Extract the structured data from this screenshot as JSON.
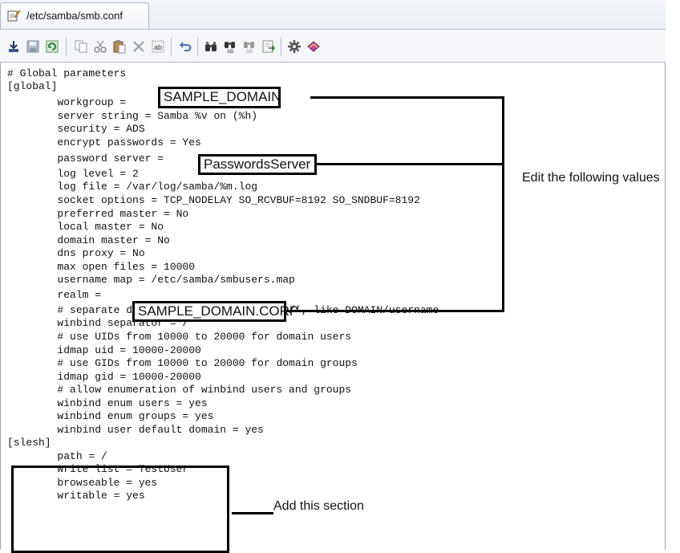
{
  "window": {
    "tab_title": "/etc/samba/smb.conf"
  },
  "toolbar": {
    "buttons": [
      "download-icon",
      "save-icon",
      "reload-icon",
      "copy-icon",
      "cut-icon",
      "paste-icon",
      "delete-icon",
      "select-all-icon",
      "undo-icon",
      "find-icon",
      "find-next-icon",
      "find-previous-icon",
      "go-to-line-icon",
      "settings-icon",
      "bookmark-icon"
    ]
  },
  "editor": {
    "lines": [
      "# Global parameters",
      "[global]",
      "        workgroup = ",
      "        server string = Samba %v on (%h)",
      "        security = ADS",
      "        encrypt passwords = Yes",
      "        password server = ",
      "        log level = 2",
      "        log file = /var/log/samba/%m.log",
      "        socket options = TCP_NODELAY SO_RCVBUF=8192 SO_SNDBUF=8192",
      "        preferred master = No",
      "        local master = No",
      "        domain master = No",
      "        dns proxy = No",
      "        max open files = 10000",
      "        username map = /etc/samba/smbusers.map",
      "        realm = ",
      "        # separate domain and username with '/', like DOMAIN/username",
      "        winbind separator = /",
      "        # use UIDs from 10000 to 20000 for domain users",
      "        idmap uid = 10000-20000",
      "        # use GIDs from 10000 to 20000 for domain groups",
      "        idmap gid = 10000-20000",
      "        # allow enumeration of winbind users and groups",
      "        winbind enum users = yes",
      "        winbind enum groups = yes",
      "        winbind user default domain = yes",
      "[slesh]",
      "        path = /",
      "        write list = TestUser",
      "        browseable = yes",
      "        writable = yes"
    ]
  },
  "callouts": {
    "workgroup_value": "SAMPLE_DOMAIN",
    "password_server_value": "PasswordsServer",
    "realm_value": "SAMPLE_DOMAIN.CORP",
    "edit_note": "Edit the following values",
    "add_note": "Add this section"
  }
}
